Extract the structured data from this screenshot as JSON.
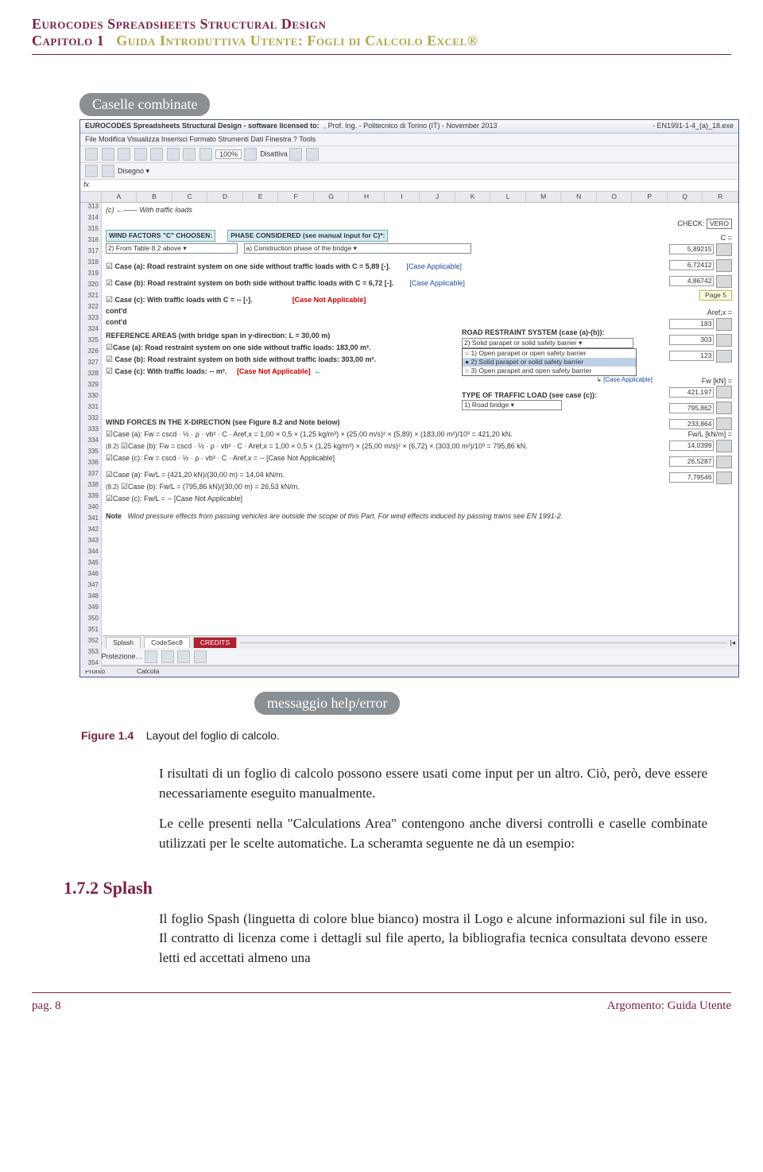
{
  "header": {
    "line1": "Eurocodes Spreadsheets Structural Design",
    "cap": "Capitolo 1",
    "rest": "Guida Introduttiva Utente: Fogli di Calcolo Excel®"
  },
  "pill_top": "Caselle combinate",
  "screenshot": {
    "title_left": "EUROCODES Spreadsheets Structural Design - software licensed to:",
    "title_mid": ", Prof. Ing. - Politecnico di Torino (IT) - November 2013",
    "title_right": "- EN1991-1-4_(a)_18.exe",
    "menu": "File   Modifica   Visualizza   Inserisci   Formato   Strumenti   Dati   Finestra   ?   Tools",
    "toolbar_zoom": "100%",
    "toolbar_dis": "Disattiva",
    "toolbar_draw": "Disegno ▾",
    "fx": "fx",
    "cols": [
      "A",
      "B",
      "C",
      "D",
      "E",
      "F",
      "G",
      "H",
      "I",
      "J",
      "K",
      "L",
      "M",
      "N",
      "O",
      "P",
      "Q",
      "R"
    ],
    "rows_start": 313,
    "rows_end": 354,
    "row313": "(c)      ←——    With traffic loads",
    "wind_hdr": "WIND FACTORS \"C\" CHOOSEN:",
    "wind_sel": "2) From Table 8.2 above            ▾",
    "phase_hdr": "PHASE CONSIDERED (see manual input for C)*:",
    "phase_sel": "a) Construction phase of the bridge                                  ▾",
    "check_lbl": "CHECK:",
    "check_val": "VERO",
    "c_eq": "C =",
    "casea1": "Case (a):  Road restraint system on one side without traffic loads with C = 5,89 [-].",
    "caseb1": "Case (b):  Road restraint system on both side without traffic loads with C = 6,72 [-].",
    "casec1": "Case (c):  With traffic loads with C = -- [-].",
    "capp": "[Case Applicable]",
    "cnapp": "[Case Not Applicable]",
    "val_a1": "5,89215",
    "val_b1": "6,72412",
    "val_c1": "4,86742",
    "contd": "cont'd",
    "page5": "Page 5",
    "ref_areas": "REFERENCE AREAS (with bridge span in y-direction: L = 30,00 m)",
    "road_sys_hdr": "ROAD RESTRAINT SYSTEM (case (a)-(b)):",
    "road_sel": "2) Solid parapet or solid safety barrier    ▾",
    "road_opt1": "1) Open parapet or open safety barrier",
    "road_opt2": "2) Solid parapet or solid safety barrier",
    "road_opt3": "3) Open parapet and open safety barrier",
    "aref_lbl": "Aref,x =",
    "casea2": "Case (a):  Road restraint system on one side without traffic loads: 183,00 m².",
    "caseb2": "Case (b):  Road restraint system on both side without traffic loads: 303,00 m².",
    "casec2": "Case (c):  With traffic loads: -- m².",
    "val_a2": "183",
    "val_b2": "303",
    "val_c2": "123",
    "traffic_hdr": "TYPE OF TRAFFIC LOAD (see case (c)):",
    "traffic_sel": "1) Road bridge        ▾",
    "wind_x_hdr": "WIND FORCES IN THE X-DIRECTION (see Figure 8.2 and Note below)",
    "fw_lbl": "Fw [kN] =",
    "eq82": "(8.2)",
    "fcasea": "Case (a): Fw = cscd · ½ · ρ · vb² · C · Aref,x = 1,00 × 0,5 × (1,25 kg/m³) × (25,00 m/s)² × (5,89) × (183,00 m²)/10³ = 421,20 kN.",
    "fcaseb": "Case (b): Fw = cscd · ½ · ρ · vb² · C · Aref,x = 1,00 × 0,5 × (1,25 kg/m³) × (25,00 m/s)² × (6,72) × (303,00 m²)/10³ = 795,86 kN.",
    "fcasec": "Case (c): Fw = cscd · ½ · ρ · vb² · C · Aref,x = -- [Case Not Applicable]",
    "val_fa": "421,197",
    "val_fb": "795,862",
    "val_fc": "233,864",
    "fwl_lbl": "Fw/L [kN/m] =",
    "lcasea": "Case (a): Fw/L = (421,20 kN)/(30,00 m) = 14,04 kN/m.",
    "lcaseb": "Case (b): Fw/L = (795,86 kN)/(30,00 m) = 26,53 kN/m.",
    "lcasec": "Case (c): Fw/L = -- [Case Not Applicable]",
    "val_la": "14,0399",
    "val_lb": "26,5287",
    "val_lc": "7,79546",
    "note_lbl": "Note",
    "note_txt": "Wind pressure effects from passing vehicles are outside the scope of this Part. For wind effects induced by passing trains see EN 1991-2.",
    "tab_splash": "Splash",
    "tab_code": "CodeSec8",
    "tab_cred": "CREDITS",
    "sb_ready": "Pronto",
    "sb_calc": "Calcola",
    "sb_prot": "Protezione…"
  },
  "pill_bottom": "messaggio help/error",
  "figure": {
    "num": "Figure 1.4",
    "cap": "Layout del foglio di calcolo."
  },
  "para1": "I risultati di un foglio di calcolo possono essere usati come input per un altro. Ciò, però, deve essere necessariamente eseguito manualmente.",
  "para2": "Le celle presenti nella \"Calculations Area\" contengono anche diversi controlli e caselle combinate utilizzati per le scelte automatiche. La scheramta seguente ne dà un esempio:",
  "section": "1.7.2 Splash",
  "para3": "Il foglio Spash (linguetta di colore blue bianco) mostra il Logo e alcune informazioni sul file in uso. Il contratto di licenza come i dettagli sul file aperto, la bibliografia tecnica consultata devono essere letti ed accettati almeno una",
  "footer": {
    "left": "pag. 8",
    "right": "Argomento: Guida Utente"
  }
}
